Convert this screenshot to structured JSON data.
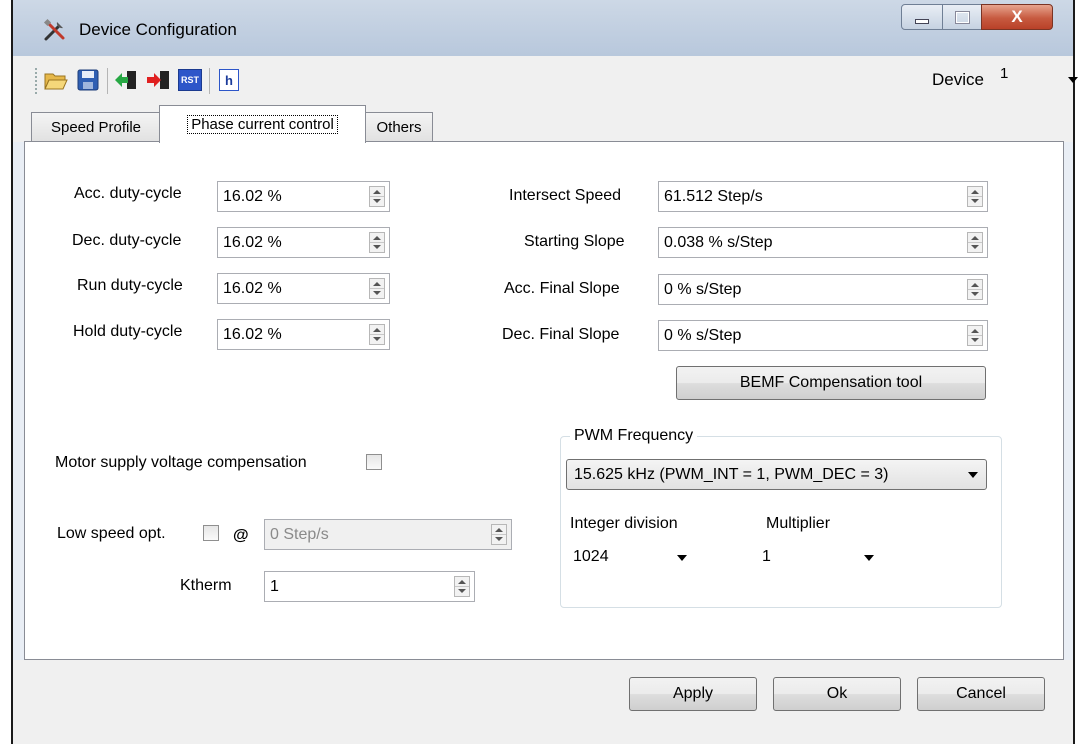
{
  "window": {
    "title": "Device Configuration"
  },
  "window_controls": {
    "close_glyph": "X"
  },
  "toolbar": {
    "icons": [
      "open-folder-icon",
      "save-icon",
      "import-icon",
      "export-icon",
      "reset-icon",
      "header-file-icon"
    ],
    "reset_label": "RST",
    "header_label": "h",
    "device_label": "Device",
    "device_value": "1"
  },
  "tabs": [
    {
      "label": "Speed Profile"
    },
    {
      "label": "Phase current control"
    },
    {
      "label": "Others"
    }
  ],
  "left_fields": [
    {
      "label": "Acc. duty-cycle",
      "value": "16.02 %"
    },
    {
      "label": "Dec. duty-cycle",
      "value": "16.02 %"
    },
    {
      "label": "Run duty-cycle",
      "value": "16.02 %"
    },
    {
      "label": "Hold duty-cycle",
      "value": "16.02 %"
    }
  ],
  "right_fields": [
    {
      "label": "Intersect Speed",
      "value": "61.512 Step/s"
    },
    {
      "label": "Starting Slope",
      "value": "0.038 % s/Step"
    },
    {
      "label": "Acc. Final Slope",
      "value": "0 % s/Step"
    },
    {
      "label": "Dec. Final Slope",
      "value": "0 % s/Step"
    }
  ],
  "bemf_button": "BEMF Compensation tool",
  "motor_supply": {
    "label": "Motor supply voltage compensation",
    "checked": false
  },
  "low_speed": {
    "label": "Low speed opt.",
    "at": "@",
    "value": "0 Step/s",
    "checked": false
  },
  "ktherm": {
    "label": "Ktherm",
    "value": "1"
  },
  "pwm": {
    "title": "PWM Frequency",
    "frequency": "15.625 kHz (PWM_INT = 1, PWM_DEC = 3)",
    "int_div_label": "Integer division",
    "int_div_value": "1024",
    "multiplier_label": "Multiplier",
    "multiplier_value": "1"
  },
  "buttons": {
    "apply": "Apply",
    "ok": "Ok",
    "cancel": "Cancel"
  }
}
